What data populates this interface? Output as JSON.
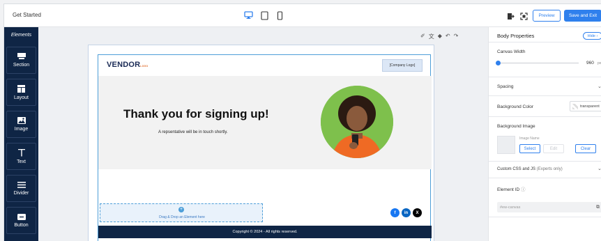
{
  "topbar": {
    "title": "Get Started",
    "preview_label": "Preview",
    "save_label": "Save and Exit"
  },
  "sidebar": {
    "title": "Elements",
    "items": [
      {
        "label": "Section",
        "icon": "section-icon"
      },
      {
        "label": "Layout",
        "icon": "layout-icon"
      },
      {
        "label": "Image",
        "icon": "image-icon"
      },
      {
        "label": "Text",
        "icon": "text-icon"
      },
      {
        "label": "Divider",
        "icon": "divider-icon"
      },
      {
        "label": "Button",
        "icon": "button-icon"
      }
    ]
  },
  "email": {
    "logo_text": "VENDOR",
    "logo_suffix": "LOGO",
    "company_logo": "[Company Logo]",
    "headline": "Thank you for signing up!",
    "subtext": "A repsentative will be in touch shortly.",
    "dropzone_text": "Drag & Drop an Element here",
    "footer_text": "Copyright © 2024 - All rights reserved."
  },
  "panel": {
    "title": "Body Properties",
    "hide_label": "Hide",
    "canvas_width_label": "Canvas Width",
    "canvas_width_value": "960",
    "canvas_width_unit": "px",
    "spacing_label": "Spacing",
    "bg_color_label": "Background Color",
    "bg_color_value": "transparent",
    "bg_image_label": "Background Image",
    "image_name_label": "Image Name",
    "select_label": "Select",
    "edit_label": "Edit",
    "clear_label": "Clear",
    "custom_css_label": "Custom CSS and JS",
    "custom_css_note": "(Experts only)",
    "element_id_label": "Element ID",
    "element_id_value": "#ew-canvas"
  },
  "colors": {
    "accent": "#2f80ed",
    "navy": "#0f2545",
    "hero_bg": "#f2f2f2"
  }
}
